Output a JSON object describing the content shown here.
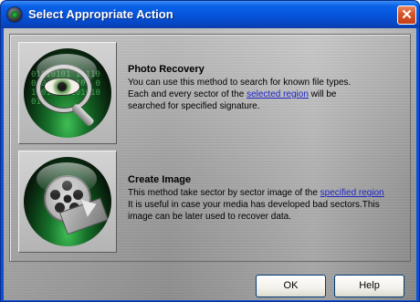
{
  "window": {
    "title": "Select Appropriate Action",
    "close_glyph": "✕"
  },
  "actions": [
    {
      "title": "Photo Recovery",
      "icon": "magnifier-eye-icon",
      "desc_line1": "You can use this method to search for known file types.",
      "desc_line2_pre": "Each and every sector of the ",
      "desc_line2_link": "selected region",
      "desc_line2_post": " will be",
      "desc_line3": "searched for specified signature."
    },
    {
      "title": "Create Image",
      "icon": "film-reel-icon",
      "desc_line1_pre": "This method take sector by sector image of the ",
      "desc_line1_link": "specified region",
      "desc_line2": "It is useful in case your media has developed bad sectors.This",
      "desc_line3": "image can be later used to recover data."
    }
  ],
  "buttons": {
    "ok": "OK",
    "help": "Help"
  },
  "colors": {
    "titlebar": "#0553d9",
    "link": "#1c25c8",
    "client": "#a8a8a8"
  }
}
